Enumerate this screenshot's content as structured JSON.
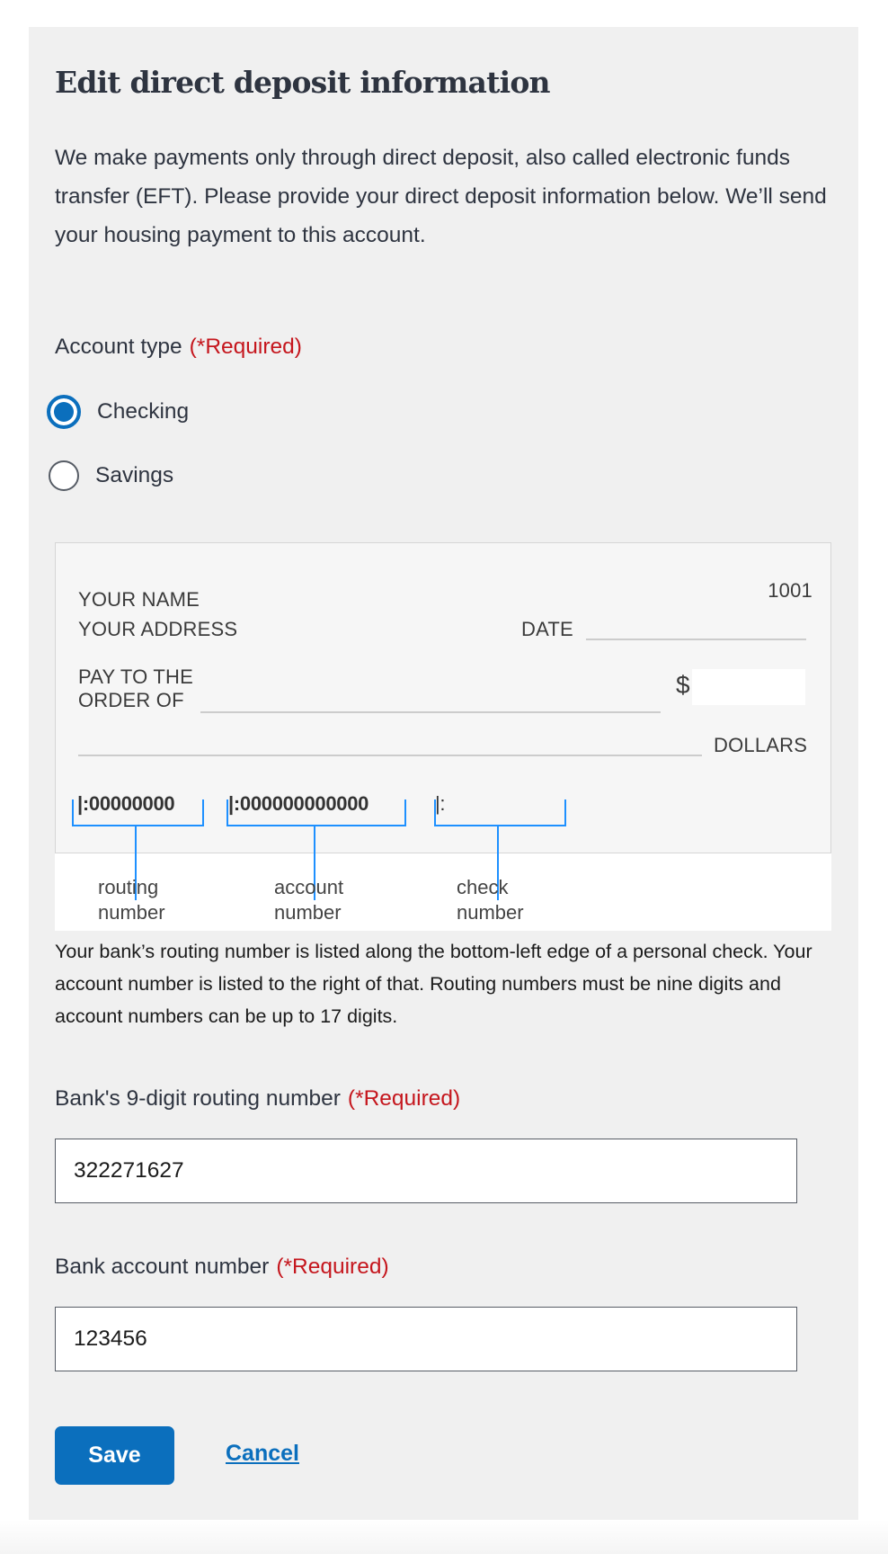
{
  "form": {
    "title": "Edit direct deposit information",
    "intro": "We make payments only through direct deposit, also called electronic funds transfer (EFT). Please provide your direct deposit information below. We’ll send your housing payment to this account.",
    "account_type": {
      "label": "Account type",
      "required": "(*Required)",
      "options": [
        {
          "label": "Checking",
          "selected": true
        },
        {
          "label": "Savings",
          "selected": false
        }
      ]
    },
    "check_image": {
      "name": "YOUR NAME",
      "address": "YOUR ADDRESS",
      "check_no": "1001",
      "date": "DATE",
      "pay_to_1": "PAY TO THE",
      "pay_to_2": "ORDER OF",
      "dollar_sign": "$",
      "dollars": "DOLLARS",
      "micr_routing": "|:00000000",
      "micr_account": "|:000000000000",
      "micr_check": "|:",
      "callouts": [
        {
          "line1": "routing",
          "line2": "number"
        },
        {
          "line1": "account",
          "line2": "number"
        },
        {
          "line1": "check",
          "line2": "number"
        }
      ]
    },
    "help_text": "Your bank’s routing number is listed along the bottom-left edge of a personal check. Your account number is listed to the right of that. Routing numbers must be nine digits and account numbers can be up to 17 digits.",
    "routing": {
      "label": "Bank's 9-digit routing number",
      "required": "(*Required)",
      "value": "322271627"
    },
    "account": {
      "label": "Bank account number",
      "required": "(*Required)",
      "value": "123456"
    },
    "buttons": {
      "save": "Save",
      "cancel": "Cancel"
    }
  },
  "colors": {
    "primary": "#0b6fbd",
    "required": "#c5161d",
    "callout": "#1e90ff"
  }
}
